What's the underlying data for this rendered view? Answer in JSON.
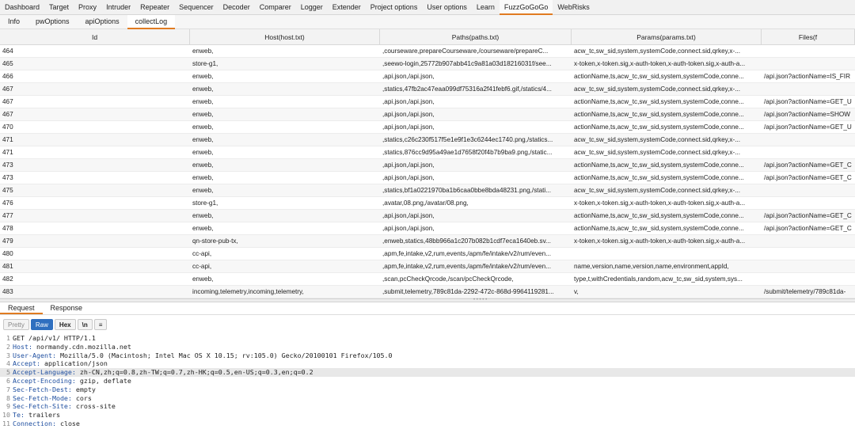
{
  "top_tabs": [
    "Dashboard",
    "Target",
    "Proxy",
    "Intruder",
    "Repeater",
    "Sequencer",
    "Decoder",
    "Comparer",
    "Logger",
    "Extender",
    "Project options",
    "User options",
    "Learn",
    "FuzzGoGoGo",
    "WebRisks"
  ],
  "top_active": "FuzzGoGoGo",
  "sub_tabs": [
    "Info",
    "pwOptions",
    "apiOptions",
    "collectLog"
  ],
  "sub_active": "collectLog",
  "table": {
    "headers": [
      "Id",
      "Host(host.txt)",
      "Paths(paths.txt)",
      "Params(params.txt)",
      "Files(f"
    ],
    "rows": [
      [
        "464",
        "enweb,",
        ",courseware,prepareCourseware,/courseware/prepareC...",
        "acw_tc,sw_sid,system,systemCode,connect.sid,qrkey,x-...",
        ""
      ],
      [
        "465",
        "store-g1,",
        ",seewo-login,25772b907abb41c9a81a03d18216031f/see...",
        "x-token,x-token.sig,x-auth-token,x-auth-token.sig,x-auth-a...",
        ""
      ],
      [
        "466",
        "enweb,",
        ",api.json,/api.json,",
        "actionName,ts,acw_tc,sw_sid,system,systemCode,conne...",
        "/api.json?actionName=IS_FIR"
      ],
      [
        "467",
        "enweb,",
        ",statics,47fb2ac47eaa099df75316a2f41febf6.gif,/statics/4...",
        "acw_tc,sw_sid,system,systemCode,connect.sid,qrkey,x-...",
        ""
      ],
      [
        "467",
        "enweb,",
        ",api.json,/api.json,",
        "actionName,ts,acw_tc,sw_sid,system,systemCode,conne...",
        "/api.json?actionName=GET_U"
      ],
      [
        "467",
        "enweb,",
        ",api.json,/api.json,",
        "actionName,ts,acw_tc,sw_sid,system,systemCode,conne...",
        "/api.json?actionName=SHOW"
      ],
      [
        "470",
        "enweb,",
        ",api.json,/api.json,",
        "actionName,ts,acw_tc,sw_sid,system,systemCode,conne...",
        "/api.json?actionName=GET_U"
      ],
      [
        "471",
        "enweb,",
        ",statics,c26c230f517f5e1e9f1e3c6244ec1740.png,/statics...",
        "acw_tc,sw_sid,system,systemCode,connect.sid,qrkey,x-...",
        ""
      ],
      [
        "471",
        "enweb,",
        ",statics,876cc9d95a49ae1d7658f20f4b7b9ba9.png,/static...",
        "acw_tc,sw_sid,system,systemCode,connect.sid,qrkey,x-...",
        ""
      ],
      [
        "473",
        "enweb,",
        ",api.json,/api.json,",
        "actionName,ts,acw_tc,sw_sid,system,systemCode,conne...",
        "/api.json?actionName=GET_C"
      ],
      [
        "473",
        "enweb,",
        ",api.json,/api.json,",
        "actionName,ts,acw_tc,sw_sid,system,systemCode,conne...",
        "/api.json?actionName=GET_C"
      ],
      [
        "475",
        "enweb,",
        ",statics,bf1a0221970ba1b6caa0bbe8bda48231.png,/stati...",
        "acw_tc,sw_sid,system,systemCode,connect.sid,qrkey,x-...",
        ""
      ],
      [
        "476",
        "store-g1,",
        ",avatar,08.png,/avatar/08.png,",
        "x-token,x-token.sig,x-auth-token,x-auth-token.sig,x-auth-a...",
        ""
      ],
      [
        "477",
        "enweb,",
        ",api.json,/api.json,",
        "actionName,ts,acw_tc,sw_sid,system,systemCode,conne...",
        "/api.json?actionName=GET_C"
      ],
      [
        "478",
        "enweb,",
        ",api.json,/api.json,",
        "actionName,ts,acw_tc,sw_sid,system,systemCode,conne...",
        "/api.json?actionName=GET_C"
      ],
      [
        "479",
        "qn-store-pub-tx,",
        ",enweb,statics,48bb966a1c207b082b1cdf7eca1640eb.sv...",
        "x-token,x-token.sig,x-auth-token,x-auth-token.sig,x-auth-a...",
        ""
      ],
      [
        "480",
        "cc-api,",
        ",apm,fe,intake,v2,rum,events,/apm/fe/intake/v2/rum/even...",
        "",
        ""
      ],
      [
        "481",
        "cc-api,",
        ",apm,fe,intake,v2,rum,events,/apm/fe/intake/v2/rum/even...",
        "name,version,name,version,name,environment,appId,",
        ""
      ],
      [
        "482",
        "enweb,",
        ",scan,pcCheckQrcode,/scan/pcCheckQrcode,",
        "type,t,withCredentials,random,acw_tc,sw_sid,system,sys...",
        ""
      ],
      [
        "483",
        "incoming,telemetry,incoming,telemetry,",
        ",submit,telemetry,789c81da-2292-472c-868d-9964119281...",
        "v,",
        "/submit/telemetry/789c81da-"
      ]
    ]
  },
  "request_tabs": [
    "Request",
    "Response"
  ],
  "request_active": "Request",
  "toolbar": {
    "pretty": "Pretty",
    "raw": "Raw",
    "hex": "Hex",
    "newline": "\\n",
    "menu": "≡"
  },
  "request_lines": [
    {
      "n": "1",
      "key": "",
      "val": "GET /api/v1/ HTTP/1.1"
    },
    {
      "n": "2",
      "key": "Host:",
      "val": " normandy.cdn.mozilla.net"
    },
    {
      "n": "3",
      "key": "User-Agent:",
      "val": " Mozilla/5.0 (Macintosh; Intel Mac OS X 10.15; rv:105.0) Gecko/20100101 Firefox/105.0"
    },
    {
      "n": "4",
      "key": "Accept:",
      "val": " application/json"
    },
    {
      "n": "5",
      "key": "Accept-Language:",
      "val": " zh-CN,zh;q=0.8,zh-TW;q=0.7,zh-HK;q=0.5,en-US;q=0.3,en;q=0.2"
    },
    {
      "n": "6",
      "key": "Accept-Encoding:",
      "val": " gzip, deflate"
    },
    {
      "n": "7",
      "key": "Sec-Fetch-Dest:",
      "val": " empty"
    },
    {
      "n": "8",
      "key": "Sec-Fetch-Mode:",
      "val": " cors"
    },
    {
      "n": "9",
      "key": "Sec-Fetch-Site:",
      "val": " cross-site"
    },
    {
      "n": "10",
      "key": "Te:",
      "val": " trailers"
    },
    {
      "n": "11",
      "key": "Connection:",
      "val": " close"
    }
  ],
  "highlight_line": "5"
}
